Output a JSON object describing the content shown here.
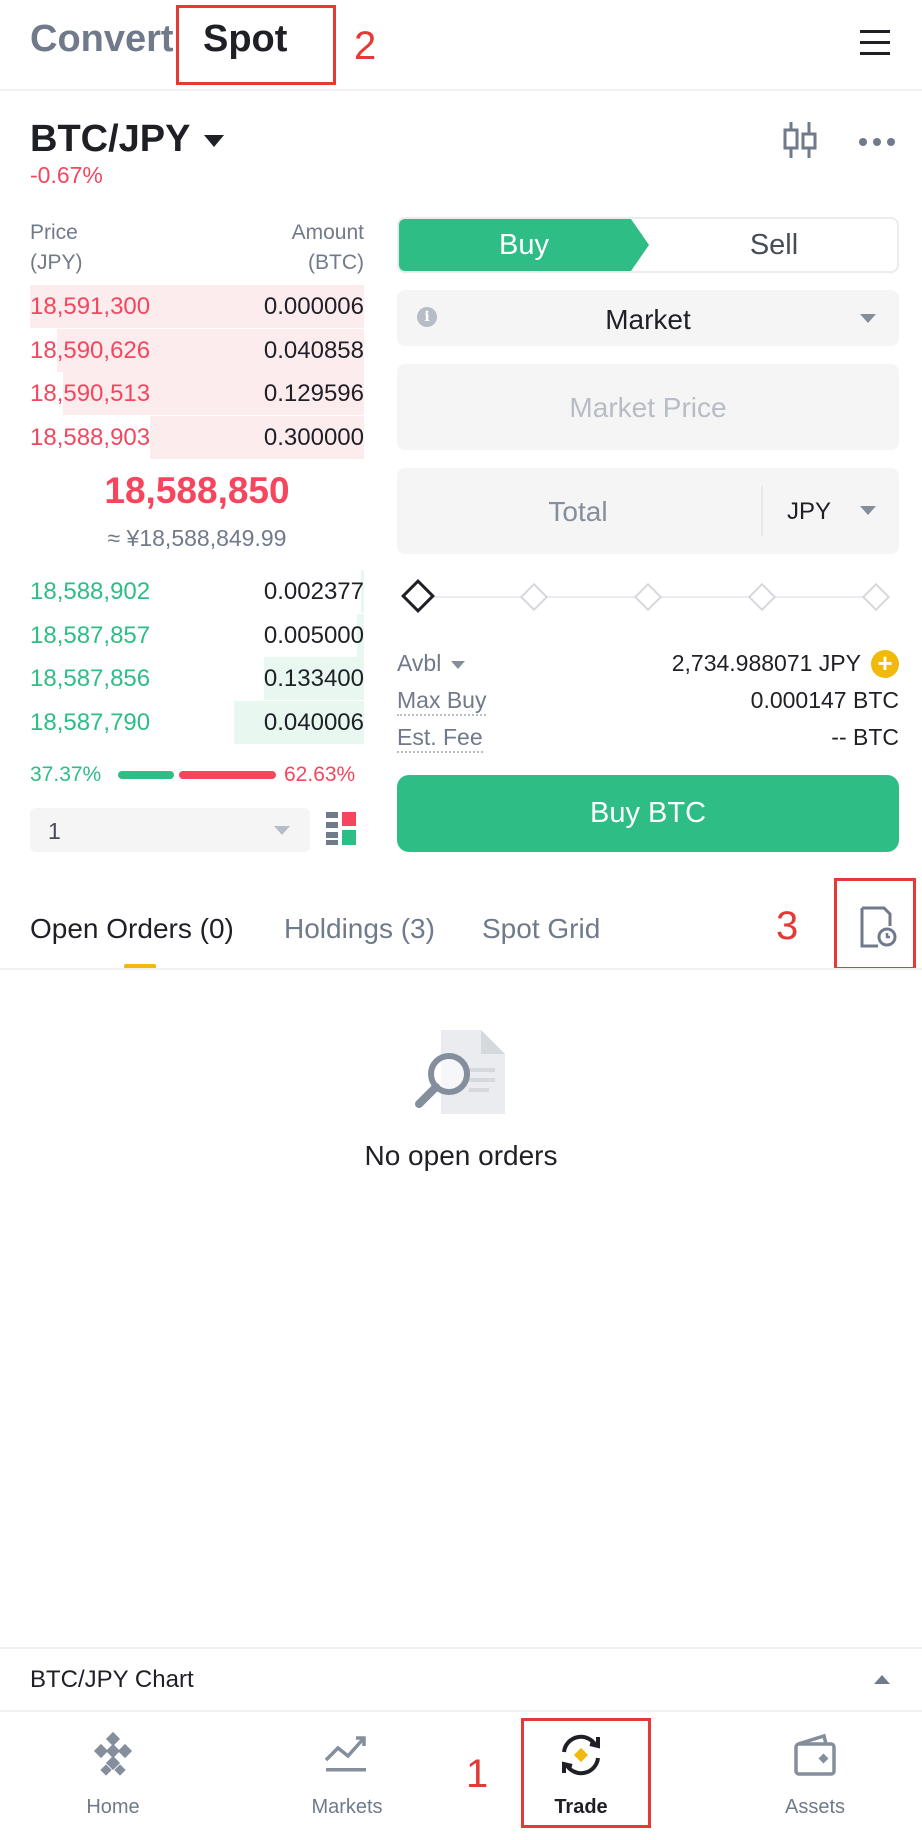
{
  "top_tabs": {
    "convert": "Convert",
    "spot": "Spot"
  },
  "annotations": {
    "n1": "1",
    "n2": "2",
    "n3": "3"
  },
  "pair": {
    "symbol": "BTC/JPY",
    "change": "-0.67%"
  },
  "orderbook": {
    "price_head": "Price",
    "price_unit": "(JPY)",
    "amount_head": "Amount",
    "amount_unit": "(BTC)",
    "asks": [
      {
        "price": "18,591,300",
        "amount": "0.000006",
        "depth": 1.0
      },
      {
        "price": "18,590,626",
        "amount": "0.040858",
        "depth": 0.92
      },
      {
        "price": "18,590,513",
        "amount": "0.129596",
        "depth": 0.9
      },
      {
        "price": "18,588,903",
        "amount": "0.300000",
        "depth": 0.64
      }
    ],
    "last_price": "18,588,850",
    "last_fiat": "≈ ¥18,588,849.99",
    "bids": [
      {
        "price": "18,588,902",
        "amount": "0.002377",
        "depth": 0.01
      },
      {
        "price": "18,587,857",
        "amount": "0.005000",
        "depth": 0.02
      },
      {
        "price": "18,587,856",
        "amount": "0.133400",
        "depth": 0.3
      },
      {
        "price": "18,587,790",
        "amount": "0.040006",
        "depth": 0.39
      }
    ],
    "buy_ratio": "37.37%",
    "sell_ratio": "62.63%",
    "depth_value": "1"
  },
  "order_form": {
    "buy_label": "Buy",
    "sell_label": "Sell",
    "order_type": "Market",
    "price_placeholder": "Market Price",
    "total_placeholder": "Total",
    "total_currency": "JPY",
    "avbl_label": "Avbl",
    "avbl_value": "2,734.988071 JPY",
    "max_buy_label": "Max Buy",
    "max_buy_value": "0.000147 BTC",
    "fee_label": "Est. Fee",
    "fee_value": "-- BTC",
    "submit_label": "Buy BTC"
  },
  "orders_tabs": {
    "open_orders": "Open Orders (0)",
    "holdings": "Holdings (3)",
    "spot_grid": "Spot Grid"
  },
  "empty_state": "No open orders",
  "chart_bar": "BTC/JPY Chart",
  "bottom_nav": [
    {
      "label": "Home",
      "icon": "binance-logo-icon"
    },
    {
      "label": "Markets",
      "icon": "chart-line-icon"
    },
    {
      "label": "Trade",
      "icon": "trade-swap-icon"
    },
    {
      "label": "Assets",
      "icon": "wallet-icon"
    }
  ],
  "colors": {
    "green": "#2ebd85",
    "red": "#f6465d",
    "yellow": "#f0b90b",
    "annotation_red": "#e53935"
  }
}
